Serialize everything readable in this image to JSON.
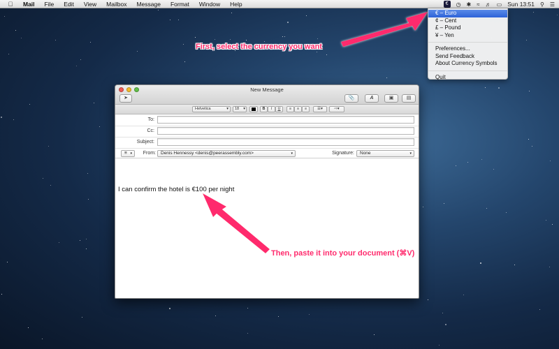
{
  "menubar": {
    "apple_icon": "apple-icon",
    "items": [
      "Mail",
      "File",
      "Edit",
      "View",
      "Mailbox",
      "Message",
      "Format",
      "Window",
      "Help"
    ],
    "clock": "Sun 13:51",
    "currency_icon_glyph": "€"
  },
  "dropdown": {
    "currencies": [
      "€ – Euro",
      "¢ – Cent",
      "£ – Pound",
      "¥ – Yen"
    ],
    "selected_index": 0,
    "actions": [
      "Preferences...",
      "Send Feedback",
      "About Currency Symbols"
    ],
    "quit": "Quit"
  },
  "annotations": {
    "first": "First, select the currency you want",
    "second": "Then, paste it into your document (⌘V)",
    "color": "#ff2b6d"
  },
  "window": {
    "title": "New Message",
    "format": {
      "font": "Helvetica",
      "size": "18"
    },
    "headers": {
      "to_label": "To:",
      "cc_label": "Cc:",
      "subject_label": "Subject:",
      "from_label": "From:",
      "from_value": "Denis Hennessy <denis@peerassembly.com>",
      "signature_label": "Signature:",
      "signature_value": "None"
    },
    "body": "I can confirm the hotel is €100 per night"
  }
}
